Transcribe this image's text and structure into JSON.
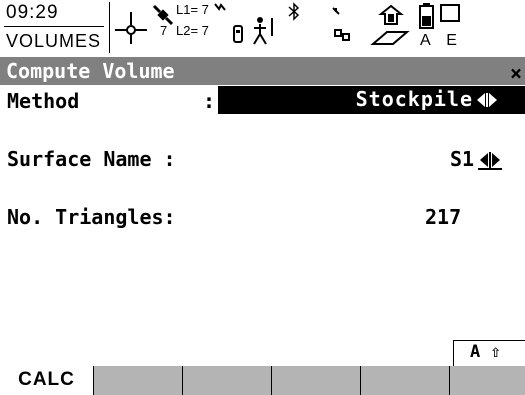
{
  "status": {
    "time": "09:29",
    "app_name": "VOLUMES",
    "satellites": {
      "l1": "L1= 7",
      "l2": "L2= 7",
      "count": "7"
    },
    "icons": [
      "crosshair-position-icon",
      "satellite-icon",
      "radio-icon",
      "bluetooth-icon",
      "link-icon",
      "memory-icon",
      "battery-icon"
    ],
    "keyboard_mode": "A E"
  },
  "title": {
    "text": "Compute Volume",
    "close": "×"
  },
  "fields": {
    "method": {
      "label": "Method",
      "colon": ":",
      "value": "Stockpile"
    },
    "surface_name": {
      "label": "Surface Name :",
      "value": "S1"
    },
    "no_triangles": {
      "label": "No. Triangles:",
      "value": "217"
    }
  },
  "keyboard_indicator": "A ⇧",
  "softkeys": [
    "CALC",
    "",
    "",
    "",
    "",
    ""
  ],
  "colors": {
    "title_bar": "#808080",
    "softkey_bar": "#b4b4b4",
    "highlight": "#000000"
  }
}
